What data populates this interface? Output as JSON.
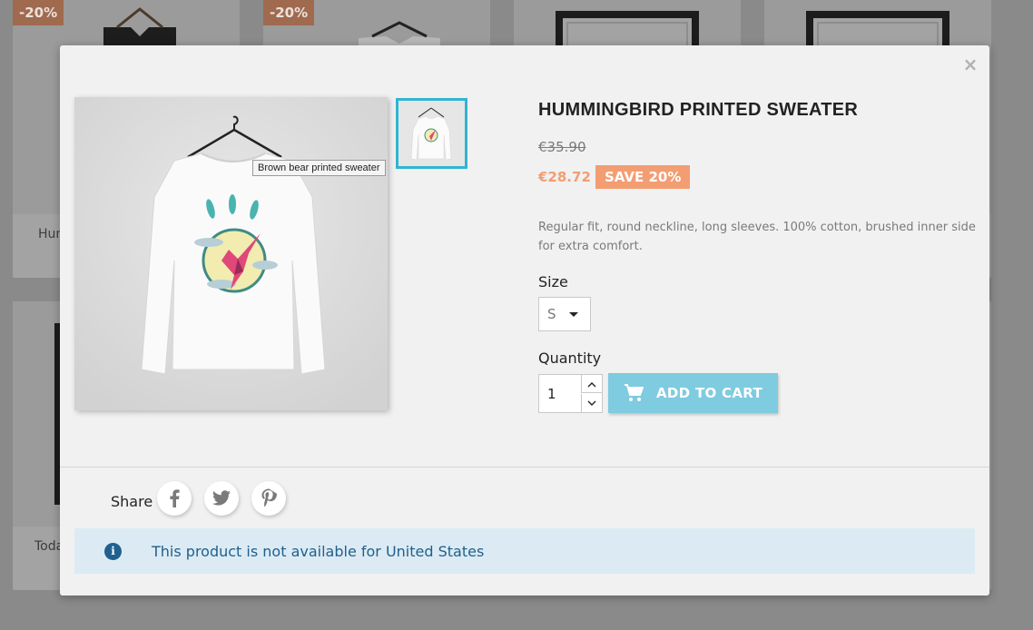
{
  "background_grid": {
    "badges": [
      "-20%",
      "-20%"
    ],
    "product_names": [
      "Hum",
      "Toda"
    ]
  },
  "modal": {
    "close_label": "×",
    "tooltip": "Brown bear printed sweater",
    "title": "HUMMINGBIRD PRINTED SWEATER",
    "old_price": "€35.90",
    "price": "€28.72",
    "discount": "SAVE 20%",
    "description": "Regular fit, round neckline, long sleeves. 100% cotton, brushed inner side for extra comfort.",
    "size_label": "Size",
    "size_value": "S",
    "quantity_label": "Quantity",
    "quantity_value": "1",
    "add_to_cart": "ADD TO CART",
    "share_label": "Share",
    "social_icons": [
      "facebook-icon",
      "twitter-icon",
      "pinterest-icon"
    ],
    "alert_text": "This product is not available for United States"
  },
  "colors": {
    "accent": "#2fb5d2",
    "discount": "#f39d72",
    "button": "#7fcbe0",
    "alert_bg": "#dcebf3",
    "alert_text": "#20608e"
  }
}
